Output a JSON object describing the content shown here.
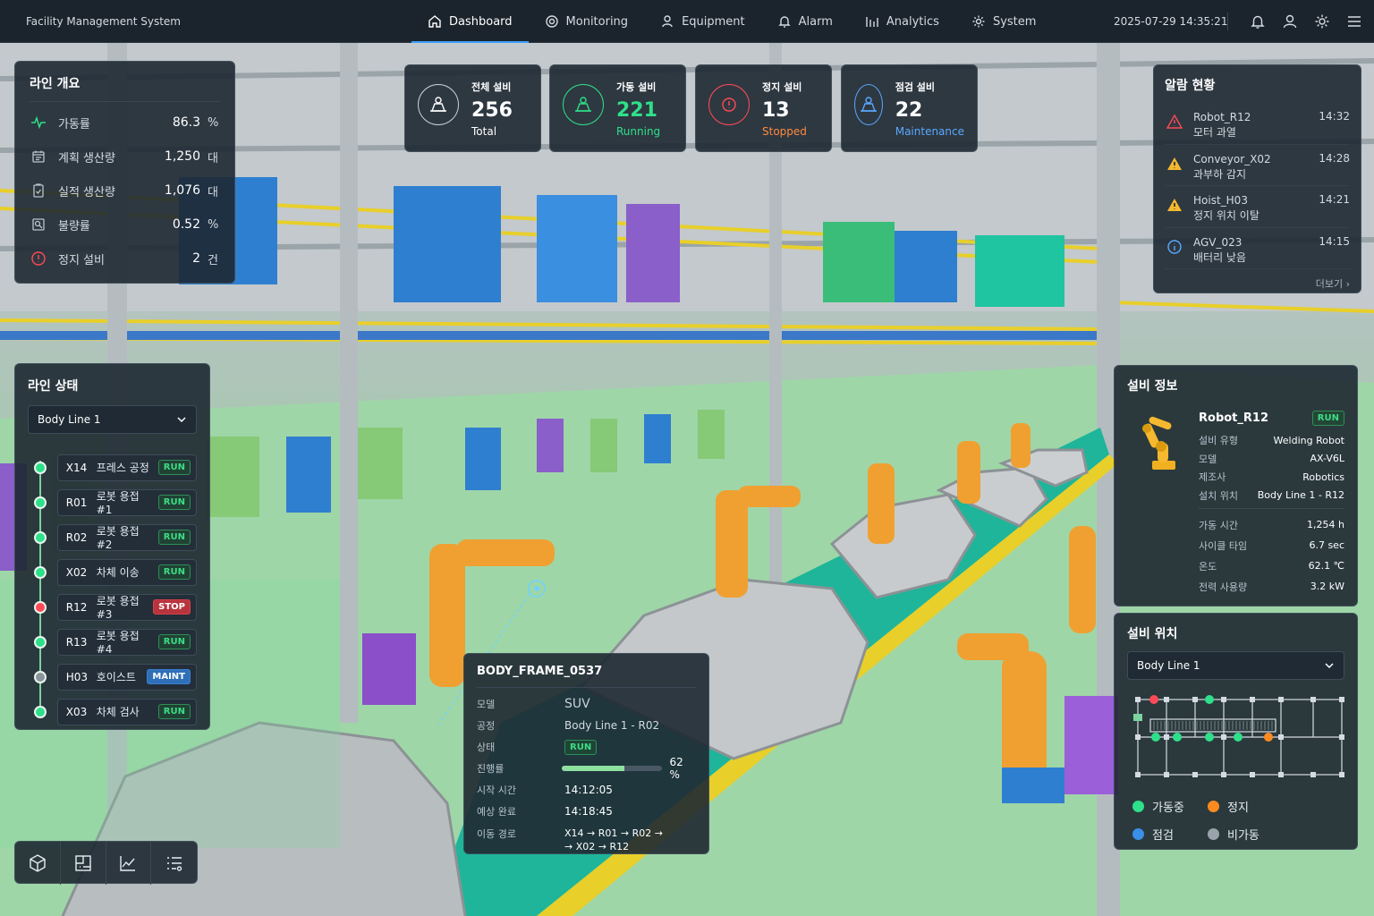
{
  "app": {
    "title": "Facility Management System",
    "datetime": "2025-07-29 14:35:21"
  },
  "nav": [
    {
      "label": "Dashboard",
      "icon": "home-icon"
    },
    {
      "label": "Monitoring",
      "icon": "monitor-icon"
    },
    {
      "label": "Equipment",
      "icon": "equipment-icon"
    },
    {
      "label": "Alarm",
      "icon": "bell-icon"
    },
    {
      "label": "Analytics",
      "icon": "bar-chart-icon"
    },
    {
      "label": "System",
      "icon": "gear-icon"
    }
  ],
  "overview": {
    "title": "라인 개요",
    "rows": [
      {
        "label": "가동률",
        "value": "86.3",
        "unit": "%"
      },
      {
        "label": "계획 생산량",
        "value": "1,250",
        "unit": "대"
      },
      {
        "label": "실적 생산량",
        "value": "1,076",
        "unit": "대"
      },
      {
        "label": "불량률",
        "value": "0.52",
        "unit": "%"
      },
      {
        "label": "정지 설비",
        "value": "2",
        "unit": "건"
      }
    ]
  },
  "kpis": [
    {
      "label": "전체 설비",
      "value": "256",
      "sub": "Total",
      "color": "#ffffff"
    },
    {
      "label": "가동 설비",
      "value": "221",
      "sub": "Running",
      "color": "#2ee08a"
    },
    {
      "label": "정지 설비",
      "value": "13",
      "sub": "Stopped",
      "color": "#ff8a3d"
    },
    {
      "label": "점검 설비",
      "value": "22",
      "sub": "Maintenance",
      "color": "#5aa8ff"
    }
  ],
  "alarms": {
    "title": "알람 현황",
    "items": [
      {
        "name": "Robot_R12",
        "desc": "모터 과열",
        "time": "14:32",
        "level": "critical"
      },
      {
        "name": "Conveyor_X02",
        "desc": "과부하 감지",
        "time": "14:28",
        "level": "warning"
      },
      {
        "name": "Hoist_H03",
        "desc": "정지 위치 이탈",
        "time": "14:21",
        "level": "warning"
      },
      {
        "name": "AGV_023",
        "desc": "배터리 낮음",
        "time": "14:15",
        "level": "info"
      }
    ],
    "more": "더보기 ›"
  },
  "line_status": {
    "title": "라인 상태",
    "selected_line": "Body Line 1",
    "items": [
      {
        "code": "X14",
        "name": "프레스 공정",
        "status": "RUN"
      },
      {
        "code": "R01",
        "name": "로봇 용접 #1",
        "status": "RUN"
      },
      {
        "code": "R02",
        "name": "로봇 용접 #2",
        "status": "RUN"
      },
      {
        "code": "X02",
        "name": "차체 이송",
        "status": "RUN"
      },
      {
        "code": "R12",
        "name": "로봇 용접 #3",
        "status": "STOP"
      },
      {
        "code": "R13",
        "name": "로봇 용접 #4",
        "status": "RUN"
      },
      {
        "code": "H03",
        "name": "호이스트",
        "status": "MAINT"
      },
      {
        "code": "X03",
        "name": "차체 검사",
        "status": "RUN"
      }
    ]
  },
  "popup": {
    "title": "BODY_FRAME_0537",
    "model_label": "모델",
    "model": "SUV",
    "process_label": "공정",
    "process": "Body Line 1 - R02",
    "status_label": "상태",
    "status": "RUN",
    "progress_label": "진행률",
    "progress_text": "62 %",
    "progress": 0.62,
    "start_label": "시작 시간",
    "start": "14:12:05",
    "eta_label": "예상 완료",
    "eta": "14:18:45",
    "route_label": "이동 경로",
    "route_line1": "X14 → R01 → R02 →",
    "route_line2": "→ X02 → R12"
  },
  "equipment": {
    "title": "설비 정보",
    "name": "Robot_R12",
    "status": "RUN",
    "specs": [
      {
        "k": "설비 유형",
        "v": "Welding Robot"
      },
      {
        "k": "모델",
        "v": "AX-V6L"
      },
      {
        "k": "제조사",
        "v": "Robotics"
      },
      {
        "k": "설치 위치",
        "v": "Body Line 1 - R12"
      }
    ],
    "metrics": [
      {
        "k": "가동 시간",
        "v": "1,254 h"
      },
      {
        "k": "사이클 타임",
        "v": "6.7 sec"
      },
      {
        "k": "온도",
        "v": "62.1 ℃"
      },
      {
        "k": "전력 사용량",
        "v": "3.2 kW"
      }
    ]
  },
  "location": {
    "title": "설비 위치",
    "selected_line": "Body Line 1",
    "legend": [
      {
        "label": "가동중",
        "color": "#2ee08a"
      },
      {
        "label": "정지",
        "color": "#ff8a1f"
      },
      {
        "label": "점검",
        "color": "#3a8fe8"
      },
      {
        "label": "비가동",
        "color": "#9aa3ab"
      }
    ]
  },
  "toolbar": [
    {
      "icon": "cube-3d-icon"
    },
    {
      "icon": "layout-map-icon"
    },
    {
      "icon": "line-chart-icon"
    },
    {
      "icon": "list-settings-icon"
    }
  ]
}
